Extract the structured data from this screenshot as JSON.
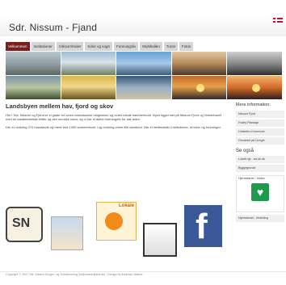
{
  "header": {
    "site_title": "Sdr. Nissum - Fjand",
    "flag_icon": "danish-flag-icon"
  },
  "nav": {
    "items": [
      {
        "label": "Velkommen"
      },
      {
        "label": "Institutioner"
      },
      {
        "label": "Virksomheder"
      },
      {
        "label": "Kirke og sogn"
      },
      {
        "label": "Foreningsliv"
      },
      {
        "label": "Multihallen"
      },
      {
        "label": "Turist"
      },
      {
        "label": "Fotos"
      }
    ]
  },
  "main": {
    "headline": "Landsbyen mellem hav, fjord og skov",
    "paragraph1": "Her i Sdr. Nissum og Fjand er vi glade for vores naturskønne omgivelser og vores lokale sammenhold. Byen ligger tæt på Nissum Fjord og Vesterhavet med de karakteristiske klitter og den smukke natur, og vi har et aktivt foreningsliv for alle aldre.",
    "paragraph2": "Der er omkring 270 husstande og mere end 1000 sommerhuse i og omkring vores lille samfund. Her er fællesskab i institutioner, erhverv og foreninger."
  },
  "sidebar": {
    "title": "Mere information:",
    "links": [
      {
        "label": "Nissum Fjord"
      },
      {
        "label": "Husby Plantage"
      },
      {
        "label": "Holstebro Kommune"
      },
      {
        "label": "Omrdetet på Google"
      }
    ],
    "see_also_title": "Se også",
    "see_also_text": "Lokalt nyt - via dn.dk",
    "boxes": [
      {
        "label": "Byggegrunde"
      }
    ],
    "defib_label": "Hjertestarter - findes",
    "bottom_link": "Nyhedsmail - tilmelding"
  },
  "logos": [
    {
      "name": "sn-logo",
      "text": "SN"
    },
    {
      "name": "puzzle-logo",
      "text": ""
    },
    {
      "name": "lokale-logo",
      "text": "Lokale"
    },
    {
      "name": "square-logo",
      "text": ""
    },
    {
      "name": "facebook-logo",
      "text": "f"
    }
  ],
  "footer": {
    "text": "Copyright © 2007 Sdr. Nissum Borger- og Turistforening (bf@nissumfjand.dk) · Design by Andreas Vidlund"
  }
}
